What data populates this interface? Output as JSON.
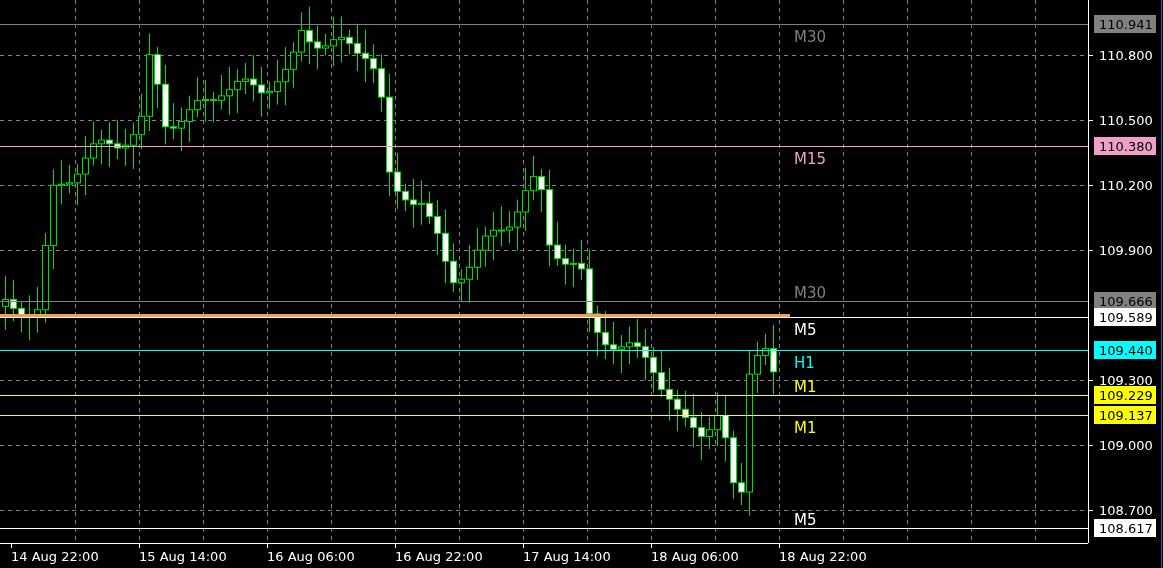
{
  "chart": {
    "highlight_line": {
      "color": "#f0a050"
    },
    "price_axis": [
      "110.800",
      "110.500",
      "110.200",
      "109.900",
      "109.300",
      "109.000",
      "108.700"
    ],
    "levels": [
      {
        "price": "110.941",
        "label": "M30",
        "color": "#808080"
      },
      {
        "price": "110.380",
        "label": "M15",
        "color": "#f0a0c8"
      },
      {
        "price": "109.666",
        "label": "M30",
        "color": "#808080"
      },
      {
        "price": "109.589",
        "label": "M5",
        "color": "#ffffff"
      },
      {
        "price": "109.440",
        "label": "H1",
        "color": "#00ffff"
      },
      {
        "price": "109.229",
        "label": "M1",
        "color": "#ffff00"
      },
      {
        "price": "109.137",
        "label": "M1",
        "color": "#ffff00"
      },
      {
        "price": "108.617",
        "label": "M5",
        "color": "#ffffff"
      }
    ],
    "time_axis": [
      "14 Aug 22:00",
      "15 Aug 14:00",
      "16 Aug 06:00",
      "16 Aug 22:00",
      "17 Aug 14:00",
      "18 Aug 06:00",
      "18 Aug 22:00"
    ]
  }
}
